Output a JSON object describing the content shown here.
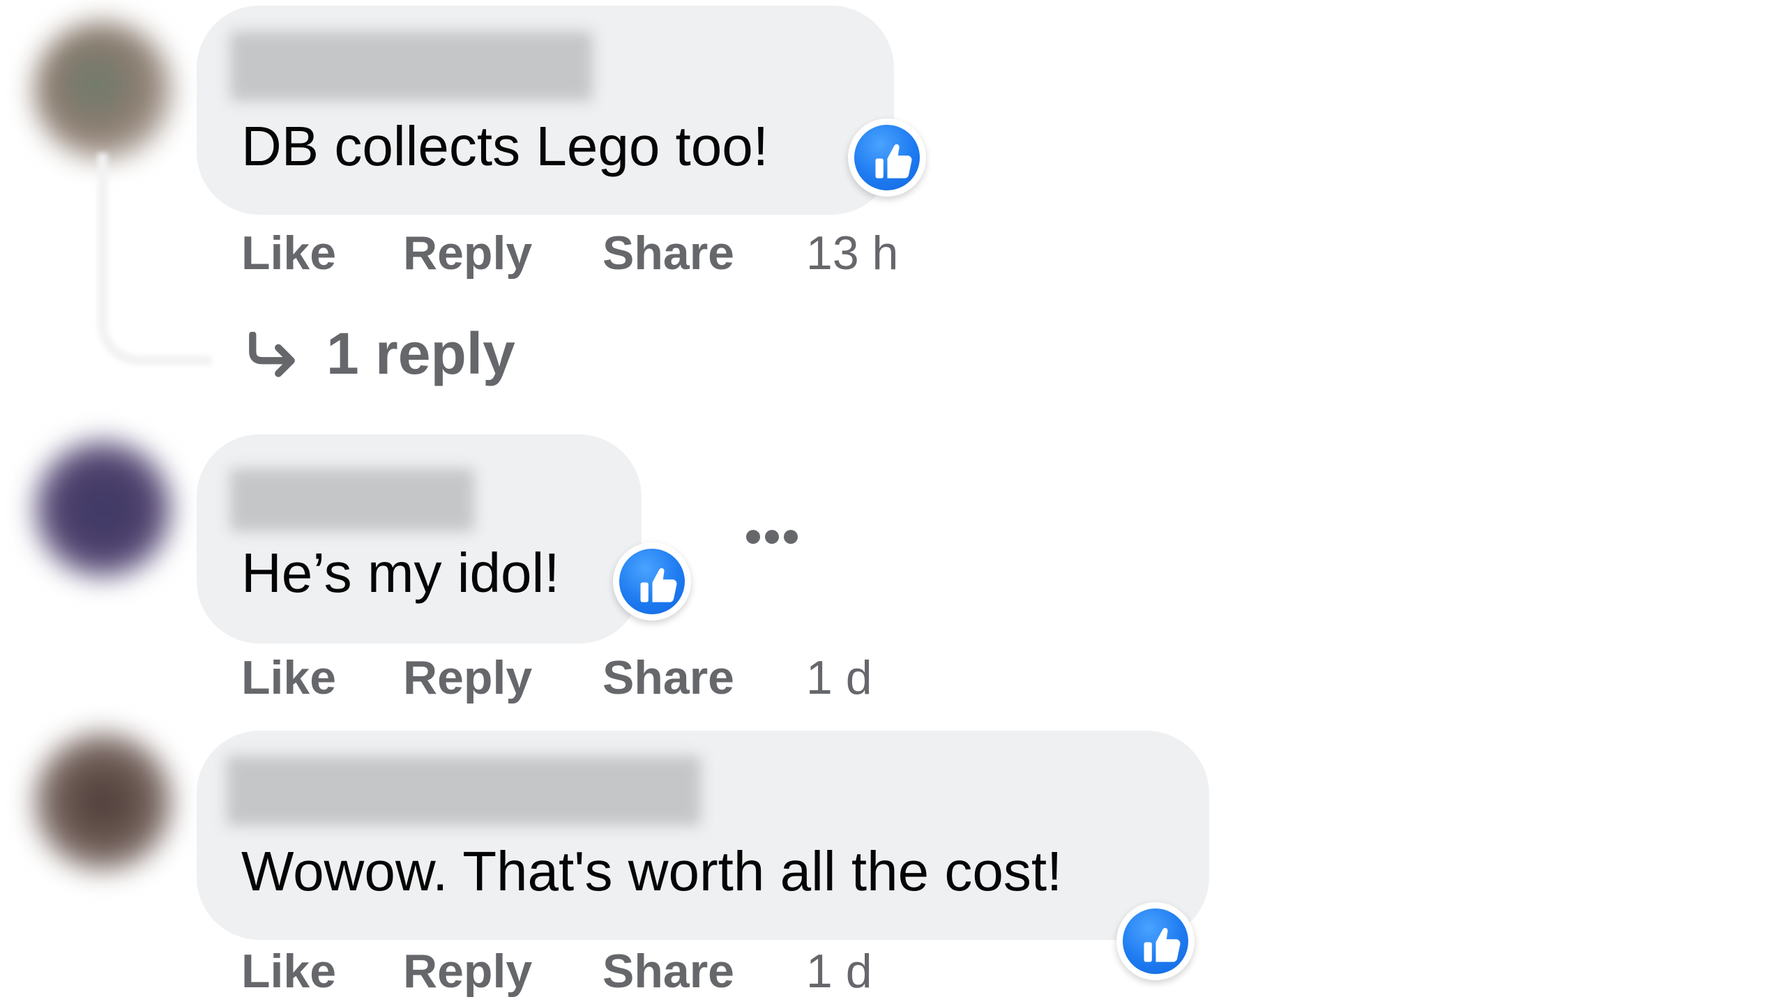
{
  "comments": [
    {
      "text": "DB collects Lego too!",
      "reaction_icon": "thumbs-up-icon",
      "actions": {
        "like": "Like",
        "reply": "Reply",
        "share": "Share",
        "time": "13 h"
      },
      "replies_link": "1 reply"
    },
    {
      "text": "He’s my idol!",
      "reaction_icon": "thumbs-up-icon",
      "actions": {
        "like": "Like",
        "reply": "Reply",
        "share": "Share",
        "time": "1 d"
      }
    },
    {
      "text": "Wowow. That's worth all the cost!",
      "reaction_icon": "thumbs-up-icon",
      "actions": {
        "like": "Like",
        "reply": "Reply",
        "share": "Share",
        "time": "1 d"
      }
    }
  ],
  "colors": {
    "bubble": "#eff0f2",
    "text": "#050505",
    "secondary_text": "#65676b",
    "like_blue": "#1e7bf0"
  }
}
